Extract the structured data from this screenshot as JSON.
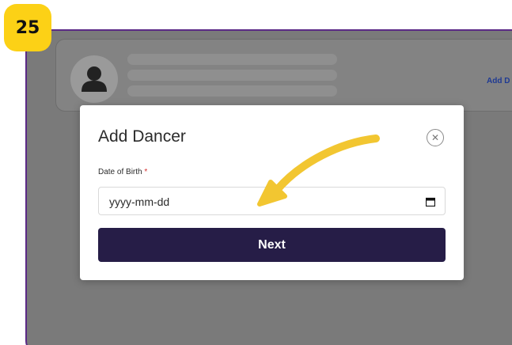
{
  "step_badge": "25",
  "profile": {
    "add_link": "Add D"
  },
  "modal": {
    "title": "Add Dancer",
    "close_icon": "close-icon",
    "field_label": "Date of Birth",
    "required_marker": "*",
    "date_placeholder": "yyyy-mm-dd",
    "calendar_icon": "calendar-icon",
    "next_label": "Next"
  },
  "colors": {
    "badge": "#fcd116",
    "primary_button": "#261d47",
    "annotation_arrow": "#f2c631",
    "frame_border": "#5b2a86",
    "link": "#1f3a93"
  }
}
